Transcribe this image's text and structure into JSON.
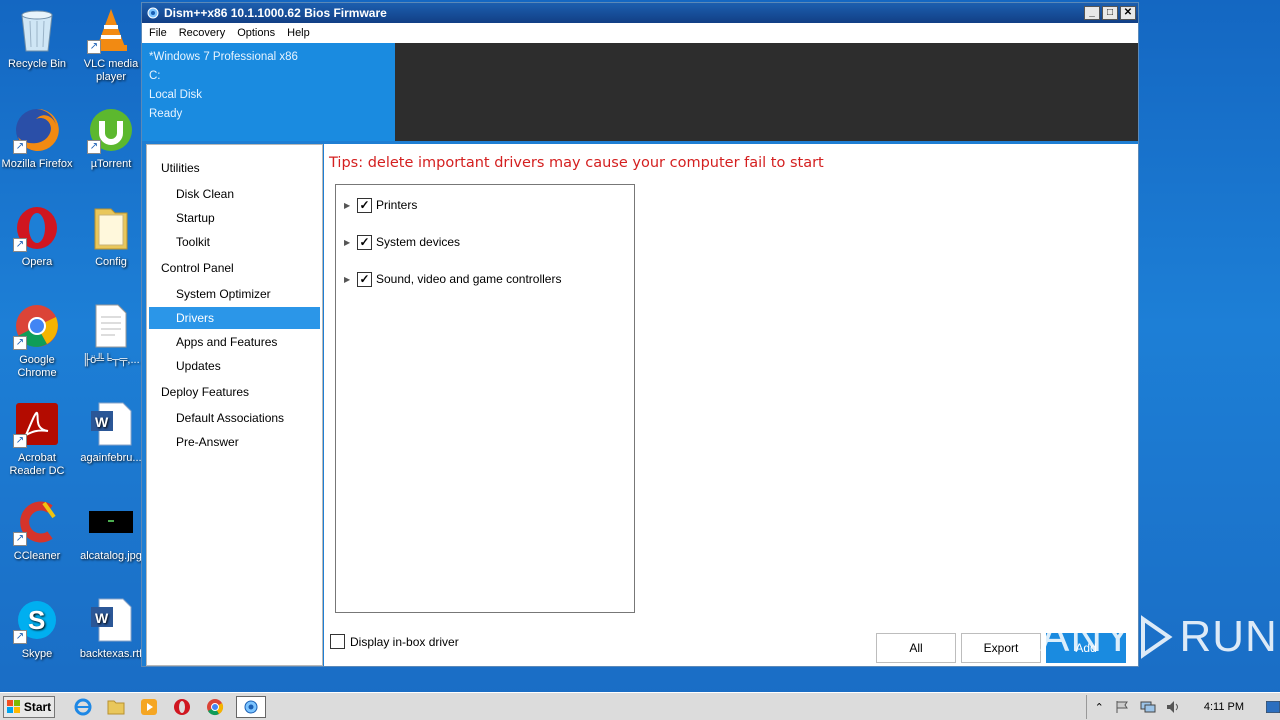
{
  "desktop": {
    "icons": [
      {
        "label": "Recycle Bin"
      },
      {
        "label": "VLC media player"
      },
      {
        "label": "Mozilla Firefox"
      },
      {
        "label": "µTorrent"
      },
      {
        "label": "Opera"
      },
      {
        "label": "Config"
      },
      {
        "label": "Google Chrome"
      },
      {
        "label": "╟ö╩╘┬╤,..."
      },
      {
        "label": "Acrobat Reader DC"
      },
      {
        "label": "againfebru..."
      },
      {
        "label": "CCleaner"
      },
      {
        "label": "alcatalog.jpg"
      },
      {
        "label": "Skype"
      },
      {
        "label": "backtexas.rtf"
      }
    ]
  },
  "window": {
    "title": "Dism++x86 10.1.1000.62 Bios Firmware",
    "controls": {
      "minimize": "_",
      "maximize": "□",
      "close": "✕"
    },
    "menu": [
      "File",
      "Recovery",
      "Options",
      "Help"
    ],
    "info": {
      "os": "*Windows 7 Professional x86",
      "drive": "C:",
      "disk": "Local Disk",
      "status": "Ready"
    },
    "sidebar": {
      "groups": [
        {
          "header": "Utilities",
          "items": [
            "Disk Clean",
            "Startup",
            "Toolkit"
          ]
        },
        {
          "header": "Control Panel",
          "items": [
            "System Optimizer",
            "Drivers",
            "Apps and Features",
            "Updates"
          ]
        },
        {
          "header": "Deploy Features",
          "items": [
            "Default Associations",
            "Pre-Answer"
          ]
        }
      ],
      "selected": "Drivers"
    },
    "main": {
      "tips": "Tips: delete important drivers may cause your computer fail to start",
      "tree": [
        {
          "label": "Printers",
          "checked": true
        },
        {
          "label": "System devices",
          "checked": true
        },
        {
          "label": "Sound, video and game controllers",
          "checked": true
        }
      ],
      "display_inbox_label": "Display in-box driver",
      "display_inbox_checked": false,
      "buttons": {
        "all": "All",
        "export": "Export",
        "add": "Add"
      }
    }
  },
  "watermark": {
    "left": "ANY",
    "right": "RUN"
  },
  "taskbar": {
    "start_label": "Start",
    "clock": "4:11 PM"
  },
  "colors": {
    "accent": "#1a8be0",
    "selected": "#2b96e8",
    "warning": "#d42020",
    "header_dark": "#2d2d2d"
  }
}
